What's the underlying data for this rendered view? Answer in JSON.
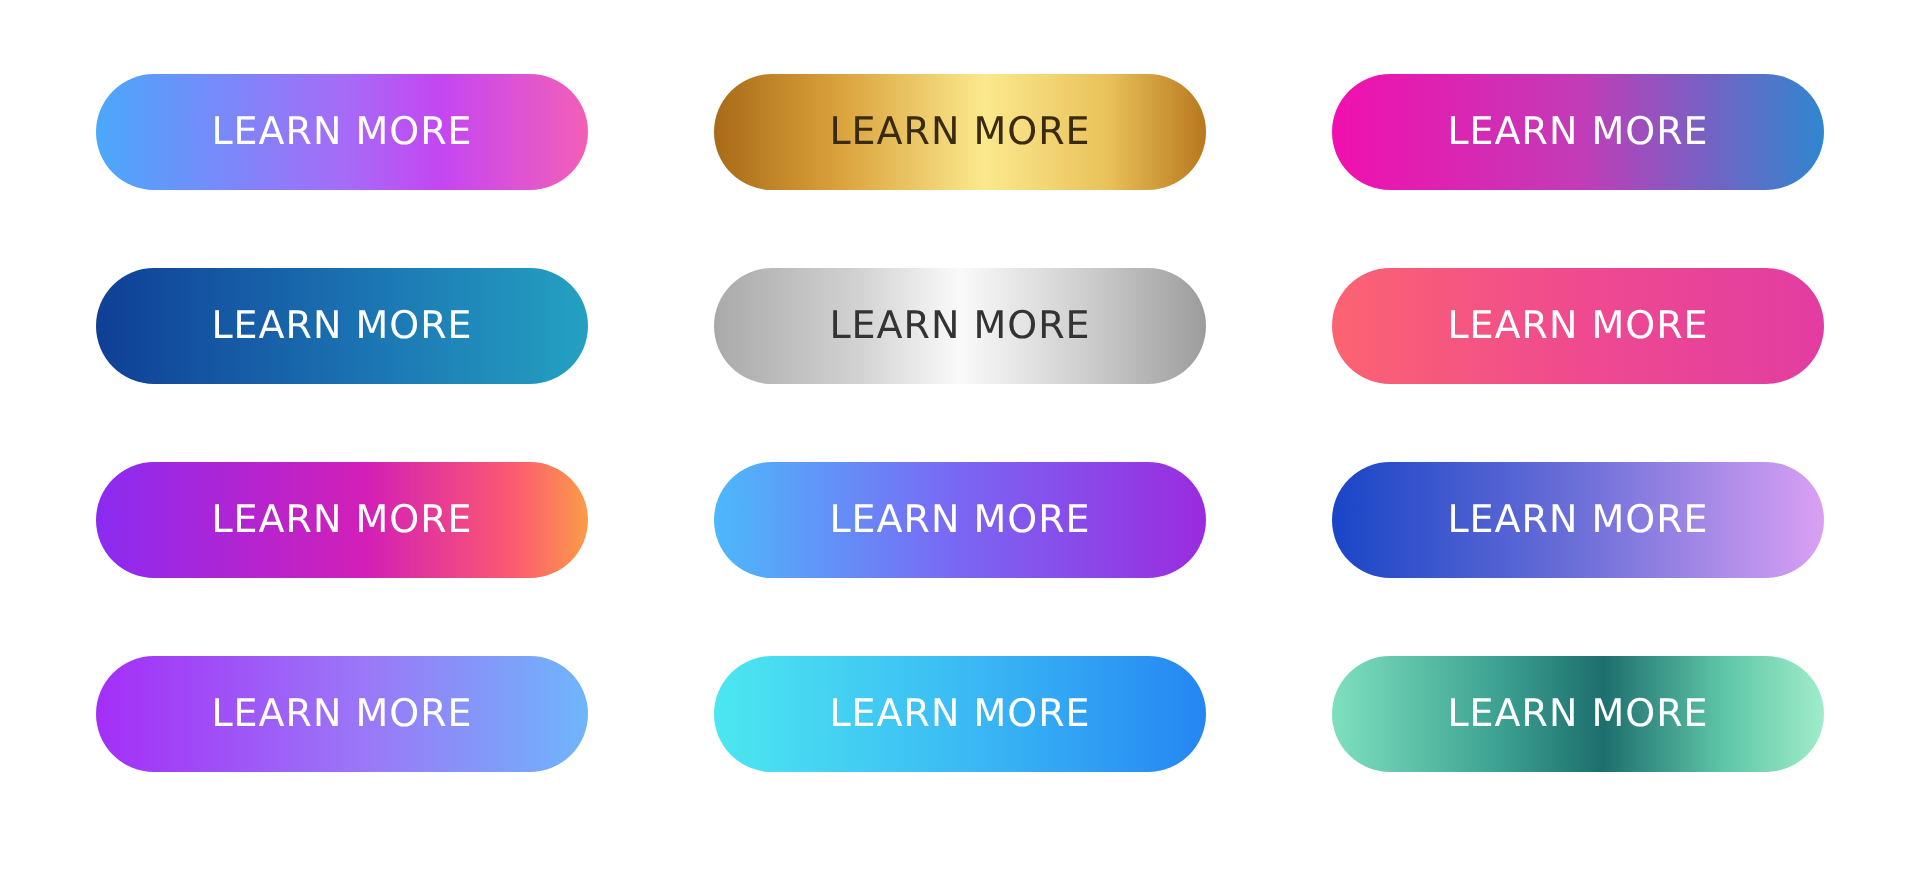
{
  "buttons": [
    {
      "label": "LEARN MORE"
    },
    {
      "label": "LEARN MORE"
    },
    {
      "label": "LEARN MORE"
    },
    {
      "label": "LEARN MORE"
    },
    {
      "label": "LEARN MORE"
    },
    {
      "label": "LEARN MORE"
    },
    {
      "label": "LEARN MORE"
    },
    {
      "label": "LEARN MORE"
    },
    {
      "label": "LEARN MORE"
    },
    {
      "label": "LEARN MORE"
    },
    {
      "label": "LEARN MORE"
    },
    {
      "label": "LEARN MORE"
    }
  ]
}
